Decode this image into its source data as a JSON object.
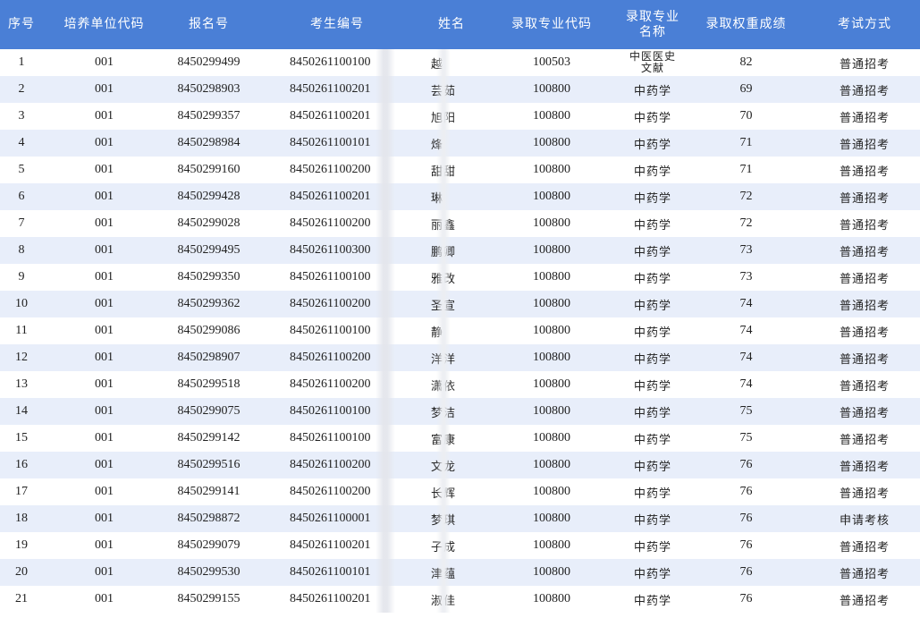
{
  "table": {
    "headers": [
      "序号",
      "培养单位代码",
      "报名号",
      "考生编号",
      "姓名",
      "录取专业代码",
      "录取专业\n名称",
      "录取权重成绩",
      "考试方式"
    ],
    "rows": [
      [
        "1",
        "001",
        "8450299499",
        "8450261100100",
        "越",
        "100503",
        "中医医史\n文献",
        "82",
        "普通招考"
      ],
      [
        "2",
        "001",
        "8450298903",
        "8450261100201",
        "芸茹",
        "100800",
        "中药学",
        "69",
        "普通招考"
      ],
      [
        "3",
        "001",
        "8450299357",
        "8450261100201",
        "旭阳",
        "100800",
        "中药学",
        "70",
        "普通招考"
      ],
      [
        "4",
        "001",
        "8450298984",
        "8450261100101",
        "烽",
        "100800",
        "中药学",
        "71",
        "普通招考"
      ],
      [
        "5",
        "001",
        "8450299160",
        "8450261100200",
        "甜甜",
        "100800",
        "中药学",
        "71",
        "普通招考"
      ],
      [
        "6",
        "001",
        "8450299428",
        "8450261100201",
        "琳",
        "100800",
        "中药学",
        "72",
        "普通招考"
      ],
      [
        "7",
        "001",
        "8450299028",
        "8450261100200",
        "丽鑫",
        "100800",
        "中药学",
        "72",
        "普通招考"
      ],
      [
        "8",
        "001",
        "8450299495",
        "8450261100300",
        "鹏卿",
        "100800",
        "中药学",
        "73",
        "普通招考"
      ],
      [
        "9",
        "001",
        "8450299350",
        "8450261100100",
        "雅改",
        "100800",
        "中药学",
        "73",
        "普通招考"
      ],
      [
        "10",
        "001",
        "8450299362",
        "8450261100200",
        "圣宣",
        "100800",
        "中药学",
        "74",
        "普通招考"
      ],
      [
        "11",
        "001",
        "8450299086",
        "8450261100100",
        "静",
        "100800",
        "中药学",
        "74",
        "普通招考"
      ],
      [
        "12",
        "001",
        "8450298907",
        "8450261100200",
        "洋洋",
        "100800",
        "中药学",
        "74",
        "普通招考"
      ],
      [
        "13",
        "001",
        "8450299518",
        "8450261100200",
        "潇依",
        "100800",
        "中药学",
        "74",
        "普通招考"
      ],
      [
        "14",
        "001",
        "8450299075",
        "8450261100100",
        "梦洁",
        "100800",
        "中药学",
        "75",
        "普通招考"
      ],
      [
        "15",
        "001",
        "8450299142",
        "8450261100100",
        "富康",
        "100800",
        "中药学",
        "75",
        "普通招考"
      ],
      [
        "16",
        "001",
        "8450299516",
        "8450261100200",
        "文龙",
        "100800",
        "中药学",
        "76",
        "普通招考"
      ],
      [
        "17",
        "001",
        "8450299141",
        "8450261100200",
        "长辉",
        "100800",
        "中药学",
        "76",
        "普通招考"
      ],
      [
        "18",
        "001",
        "8450298872",
        "8450261100001",
        "梦琪",
        "100800",
        "中药学",
        "76",
        "申请考核"
      ],
      [
        "19",
        "001",
        "8450299079",
        "8450261100201",
        "子成",
        "100800",
        "中药学",
        "76",
        "普通招考"
      ],
      [
        "20",
        "001",
        "8450299530",
        "8450261100101",
        "津蕴",
        "100800",
        "中药学",
        "76",
        "普通招考"
      ],
      [
        "21",
        "001",
        "8450299155",
        "8450261100201",
        "淑佳",
        "100800",
        "中药学",
        "76",
        "普通招考"
      ]
    ]
  }
}
